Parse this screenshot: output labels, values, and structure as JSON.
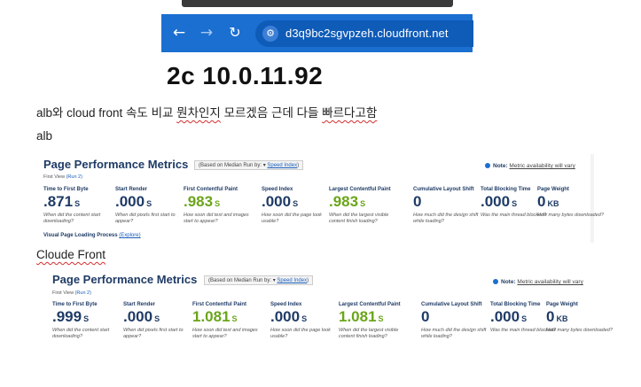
{
  "browser": {
    "url": "d3q9bc2sgvpzeh.cloudfront.net"
  },
  "heading": "2c 10.0.11.92",
  "note": {
    "prefix": "alb와 cloud front 속도 비교 ",
    "word1": "뭔차인지",
    "middle": " 모르겠음 근데 다들 ",
    "word2": "빠르다고함"
  },
  "alb_label": "alb",
  "cf_label": "Cloude Front",
  "panels": {
    "alb": {
      "title": "Page Performance Metrics",
      "basis_text": "(Based on Median Run by: ▾",
      "basis_link": "Speed Index",
      "basis_close": ")",
      "note_label": "Note:",
      "note_text": "Metric availability will vary",
      "first_view": "First View",
      "run": "(Run 2)",
      "metrics": [
        {
          "label": "Time to First Byte",
          "value": ".871",
          "unit": "S",
          "desc": "When did the content start downloading?"
        },
        {
          "label": "Start Render",
          "value": ".000",
          "unit": "S",
          "desc": "When did pixels first start to appear?"
        },
        {
          "label": "First Contentful Paint",
          "value": ".983",
          "unit": "S",
          "desc": "How soon did text and images start to appear?"
        },
        {
          "label": "Speed Index",
          "value": ".000",
          "unit": "S",
          "desc": "How soon did the page look usable?"
        },
        {
          "label": "Largest Contentful Paint",
          "value": ".983",
          "unit": "S",
          "desc": "When did the largest visible content finish loading?"
        },
        {
          "label": "Cumulative Layout Shift",
          "value": "0",
          "unit": "",
          "desc": "How much did the design shift while loading?"
        },
        {
          "label": "Total Blocking Time",
          "value": ".000",
          "unit": "S",
          "desc": "Was the main thread blocked?"
        },
        {
          "label": "Page Weight",
          "value": "0",
          "unit": "KB",
          "desc": "How many bytes downloaded?"
        }
      ],
      "visual_label": "Visual Page Loading Process",
      "visual_link": "(Explore)"
    },
    "cf": {
      "title": "Page Performance Metrics",
      "basis_text": "(Based on Median Run by: ▾",
      "basis_link": "Speed Index",
      "basis_close": ")",
      "note_label": "Note:",
      "note_text": "Metric availability will vary",
      "first_view": "First View",
      "run": "(Run 2)",
      "metrics": [
        {
          "label": "Time to First Byte",
          "value": ".999",
          "unit": "S",
          "desc": "When did the content start downloading?"
        },
        {
          "label": "Start Render",
          "value": ".000",
          "unit": "S",
          "desc": "When did pixels first start to appear?"
        },
        {
          "label": "First Contentful Paint",
          "value": "1.081",
          "unit": "S",
          "desc": "How soon did text and images start to appear?"
        },
        {
          "label": "Speed Index",
          "value": ".000",
          "unit": "S",
          "desc": "How soon did the page look usable?"
        },
        {
          "label": "Largest Contentful Paint",
          "value": "1.081",
          "unit": "S",
          "desc": "When did the largest visible content finish loading?"
        },
        {
          "label": "Cumulative Layout Shift",
          "value": "0",
          "unit": "",
          "desc": "How much did the design shift while loading?"
        },
        {
          "label": "Total Blocking Time",
          "value": ".000",
          "unit": "S",
          "desc": "Was the main thread blocked?"
        },
        {
          "label": "Page Weight",
          "value": "0",
          "unit": "KB",
          "desc": "How many bytes downloaded?"
        }
      ]
    }
  },
  "colors": {
    "browser_bar": "#1b6fd1",
    "metric_navy": "#1f3b66",
    "metric_green": "#6aa51a",
    "link_blue": "#1b5fb8",
    "spell_underline": "#d32f2f"
  },
  "icons": {
    "back": "back-arrow-icon",
    "forward": "forward-arrow-icon",
    "reload": "reload-icon",
    "site_info": "site-info-icon",
    "note": "info-dot-icon"
  }
}
